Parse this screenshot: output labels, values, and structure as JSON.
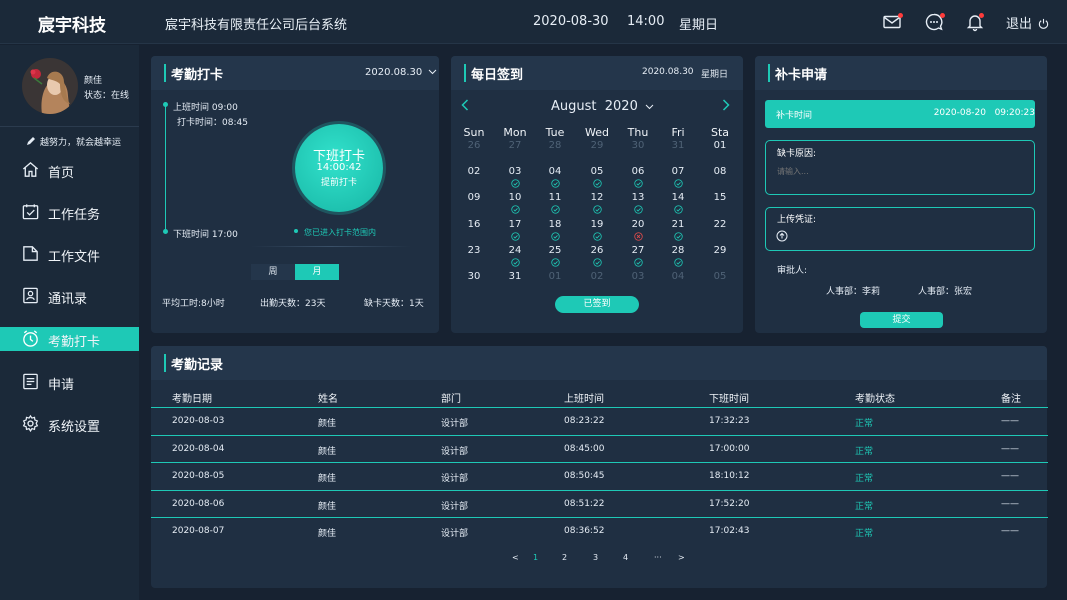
{
  "header": {
    "brand": "宸宇科技",
    "system_title": "宸宇科技有限责任公司后台系统",
    "date": "2020-08-30",
    "time": "14:00",
    "weekday": "星期日",
    "logout": "退出"
  },
  "user": {
    "name": "颜佳",
    "status": "状态：在线",
    "motto": "越努力，就会越幸运"
  },
  "nav": [
    {
      "label": "首页",
      "icon": "home-icon"
    },
    {
      "label": "工作任务",
      "icon": "task-icon"
    },
    {
      "label": "工作文件",
      "icon": "folder-icon"
    },
    {
      "label": "通讯录",
      "icon": "contacts-icon"
    },
    {
      "label": "考勤打卡",
      "icon": "clock-icon",
      "active": true
    },
    {
      "label": "申请",
      "icon": "form-icon"
    },
    {
      "label": "系统设置",
      "icon": "gear-icon"
    }
  ],
  "attendance": {
    "title": "考勤打卡",
    "date": "2020.08.30",
    "on_duty": "上班时间 09:00",
    "punch_time": "打卡时间：08:45",
    "off_duty": "下班时间 17:00",
    "punch_button_title": "下班打卡",
    "punch_button_time": "14:00:42",
    "punch_button_note": "提前打卡",
    "in_range": "您已进入打卡范围内",
    "toggle_week": "周",
    "toggle_month": "月",
    "avg_hours": "平均工时:8小时",
    "attend_days": "出勤天数：23天",
    "missing_days": "缺卡天数：1天"
  },
  "calendar": {
    "title": "每日签到",
    "date": "2020.08.30",
    "weekday": "星期日",
    "month_label": "August  2020",
    "weekdays": [
      "Sun",
      "Mon",
      "Tue",
      "Wed",
      "Thu",
      "Fri",
      "Sta"
    ],
    "weeks": [
      [
        {
          "d": "26",
          "dim": true
        },
        {
          "d": "27",
          "dim": true
        },
        {
          "d": "28",
          "dim": true
        },
        {
          "d": "29",
          "dim": true
        },
        {
          "d": "30",
          "dim": true
        },
        {
          "d": "31",
          "dim": true
        },
        {
          "d": "01"
        }
      ],
      [
        {
          "d": "02"
        },
        {
          "d": "03",
          "m": "ok"
        },
        {
          "d": "04",
          "m": "ok"
        },
        {
          "d": "05",
          "m": "ok"
        },
        {
          "d": "06",
          "m": "ok"
        },
        {
          "d": "07",
          "m": "ok"
        },
        {
          "d": "08"
        }
      ],
      [
        {
          "d": "09"
        },
        {
          "d": "10",
          "m": "ok"
        },
        {
          "d": "11",
          "m": "ok"
        },
        {
          "d": "12",
          "m": "ok"
        },
        {
          "d": "13",
          "m": "ok"
        },
        {
          "d": "14",
          "m": "ok"
        },
        {
          "d": "15"
        }
      ],
      [
        {
          "d": "16"
        },
        {
          "d": "17",
          "m": "ok"
        },
        {
          "d": "18",
          "m": "ok"
        },
        {
          "d": "19",
          "m": "ok"
        },
        {
          "d": "20",
          "m": "miss"
        },
        {
          "d": "21",
          "m": "ok"
        },
        {
          "d": "22"
        }
      ],
      [
        {
          "d": "23"
        },
        {
          "d": "24",
          "m": "ok"
        },
        {
          "d": "25",
          "m": "ok"
        },
        {
          "d": "26",
          "m": "ok"
        },
        {
          "d": "27",
          "m": "ok"
        },
        {
          "d": "28",
          "m": "ok"
        },
        {
          "d": "29"
        }
      ],
      [
        {
          "d": "30"
        },
        {
          "d": "31"
        },
        {
          "d": "01",
          "dim": true
        },
        {
          "d": "02",
          "dim": true
        },
        {
          "d": "03",
          "dim": true
        },
        {
          "d": "04",
          "dim": true
        },
        {
          "d": "05",
          "dim": true
        }
      ]
    ],
    "signed_button": "已签到",
    "colors": {
      "ok": "#1ec9b6",
      "miss": "#e04b4b"
    }
  },
  "supplement": {
    "title": "补卡申请",
    "time_label": "补卡时间",
    "time_value": "2020-08-20   09:20:23",
    "reason_label": "缺卡原因:",
    "reason_placeholder": "请输入...",
    "proof_label": "上传凭证:",
    "approver_label": "审批人:",
    "approver_1": "人事部：李莉",
    "approver_2": "人事部：张宏",
    "submit": "提交"
  },
  "records": {
    "title": "考勤记录",
    "columns": [
      "考勤日期",
      "姓名",
      "部门",
      "上班时间",
      "下班时间",
      "考勤状态",
      "备注"
    ],
    "rows": [
      [
        "2020-08-03",
        "颜佳",
        "设计部",
        "08:23:22",
        "17:32:23",
        "正常",
        "——"
      ],
      [
        "2020-08-04",
        "颜佳",
        "设计部",
        "08:45:00",
        "17:00:00",
        "正常",
        "——"
      ],
      [
        "2020-08-05",
        "颜佳",
        "设计部",
        "08:50:45",
        "18:10:12",
        "正常",
        "——"
      ],
      [
        "2020-08-06",
        "颜佳",
        "设计部",
        "08:51:22",
        "17:52:20",
        "正常",
        "——"
      ],
      [
        "2020-08-07",
        "颜佳",
        "设计部",
        "08:36:52",
        "17:02:43",
        "正常",
        "——"
      ]
    ],
    "pagination": [
      "<",
      "1",
      "2",
      "3",
      "4",
      "···",
      ">"
    ],
    "current_page": "1"
  },
  "colors": {
    "accent": "#1ec9b6",
    "background": "#172231",
    "panel": "#1f2f42",
    "alert_dot": "#ff3b3b"
  }
}
